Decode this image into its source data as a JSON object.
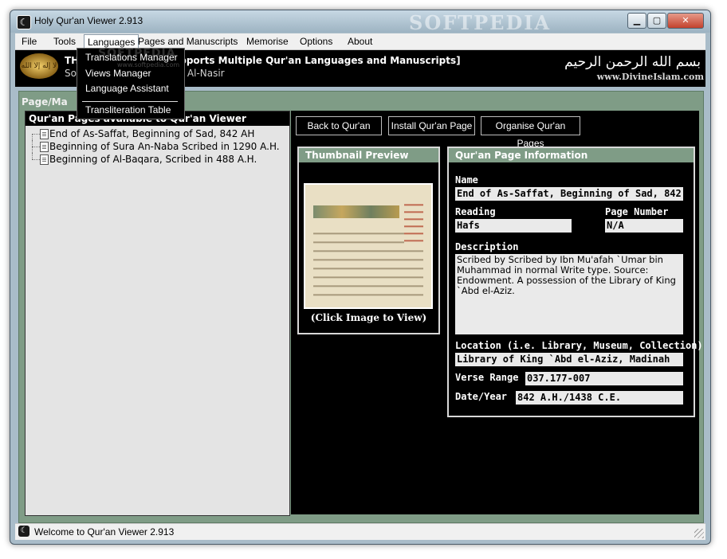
{
  "window": {
    "title": "Holy Qur'an Viewer 2.913",
    "watermark": "SOFTPEDIA",
    "controls": {
      "minimize": "▁",
      "maximize": "▢",
      "close": "✕"
    }
  },
  "menu": [
    "File",
    "Tools",
    "Languages",
    "Pages and Manuscripts",
    "Memorise",
    "Options",
    "About"
  ],
  "dropdown": {
    "items": [
      "Translations Manager",
      "Views Manager",
      "Language Assistant",
      "Transliteration Table"
    ],
    "overlay_watermark": "SOFTPEDIA",
    "overlay_url": "www.softpedia.com"
  },
  "banner": {
    "line1_prefix": "TH",
    "line1_suffix": "pports Multiple Qur'an Languages and Manuscripts]",
    "line2_prefix": "So",
    "line2_suffix": "rmal Al-Nasir",
    "logo_text": "لا إله إلا الله",
    "calligraphy": "بسم الله الرحمن الرحيم",
    "site": "www.DivineIslam.com"
  },
  "frame_title": "Page/Ma",
  "left_panel": {
    "header": "Qur'an Pages available to Qur'an Viewer",
    "items": [
      "End of As-Saffat, Beginning of Sad, 842 AH",
      "Beginning of Sura An-Naba Scribed in 1290 A.H.",
      "Beginning of Al-Baqara, Scribed in 488 A.H."
    ]
  },
  "toolbar": {
    "back": "Back to Qur'an",
    "install": "Install Qur'an Page",
    "organise": "Organise Qur'an Pages"
  },
  "thumbnail": {
    "header": "Thumbnail Preview",
    "caption": "(Click Image to View)"
  },
  "info": {
    "header": "Qur'an Page Information",
    "name_label": "Name",
    "name": "End of As-Saffat, Beginning of Sad, 842 AH",
    "reading_label": "Reading",
    "reading": "Hafs",
    "page_number_label": "Page Number",
    "page_number": "N/A",
    "description_label": "Description",
    "description": "Scribed by Scribed by Ibn Mu'afah `Umar bin Muhammad in normal Write type. Source: Endowment. A possession of the Library of King `Abd el-Aziz.",
    "location_label": "Location (i.e. Library, Museum, Collection)",
    "location": "Library of King `Abd el-Aziz, Madinah",
    "verse_range_label": "Verse Range",
    "verse_range": "037.177-007",
    "date_label": "Date/Year",
    "date": "842 A.H./1438 C.E."
  },
  "status": {
    "text": "Welcome to Qur'an Viewer 2.913"
  },
  "colors": {
    "frame_green": "#7f9c86",
    "panel_bg": "#000000",
    "field_bg": "#eaeaea"
  }
}
